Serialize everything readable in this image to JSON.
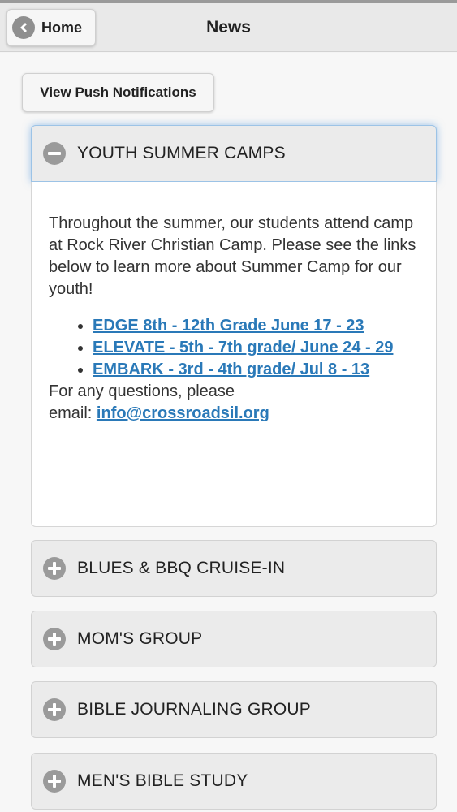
{
  "header": {
    "home_label": "Home",
    "title": "News"
  },
  "push_button": {
    "label": "View Push Notifications"
  },
  "sections": [
    {
      "title": "YOUTH SUMMER CAMPS",
      "expanded": true,
      "body": {
        "intro": "Throughout the summer, our students attend camp at Rock River Christian Camp. Please see the links below to learn more about Summer Camp for our youth!",
        "links": [
          "EDGE 8th - 12th Grade June 17 - 23",
          "ELEVATE - 5th - 7th grade/ June 24 - 29",
          "EMBARK - 3rd - 4th grade/ Jul 8 - 13"
        ],
        "contact_prefix_1": "For any questions, please",
        "contact_prefix_2": "email:",
        "email": "info@crossroadsil.org"
      }
    },
    {
      "title": "BLUES & BBQ CRUISE-IN",
      "expanded": false
    },
    {
      "title": "MOM'S GROUP",
      "expanded": false
    },
    {
      "title": "BIBLE JOURNALING GROUP",
      "expanded": false
    },
    {
      "title": "MEN'S BIBLE STUDY",
      "expanded": false
    }
  ],
  "icons": {
    "home": "chevron-left-circle-icon",
    "expanded": "minus-circle-icon",
    "collapsed": "plus-circle-icon"
  },
  "colors": {
    "link": "#2a79b8",
    "focus_glow": "#9cc3e6",
    "icon_gray": "#9a9a9a"
  }
}
